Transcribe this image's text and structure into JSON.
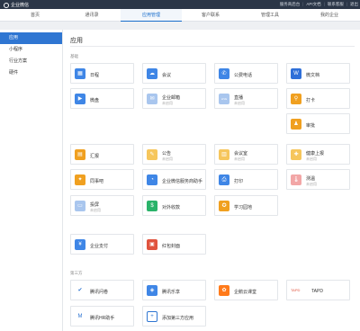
{
  "topbar": {
    "logo_text": "企业微信",
    "links": [
      "服务商后台",
      "API文档",
      "联系客服",
      "退出"
    ]
  },
  "nav": {
    "tabs": [
      "首页",
      "通讯录",
      "应用管理",
      "客户联系",
      "管理工具",
      "我的企业"
    ],
    "active": 2
  },
  "sidebar": {
    "items": [
      "应用",
      "小程序",
      "行业方案",
      "硬件"
    ],
    "active": 0
  },
  "main": {
    "title": "应用",
    "section_basic": "基础",
    "section_third": "第三方"
  },
  "cards": [
    {
      "name": "日程",
      "sub": "",
      "icon": "calendar-icon",
      "color": "#3f86e6",
      "glyph": "▦"
    },
    {
      "name": "会议",
      "sub": "",
      "icon": "meeting-icon",
      "color": "#3f86e6",
      "glyph": "☁"
    },
    {
      "name": "公费电话",
      "sub": "",
      "icon": "phone-icon",
      "color": "#3f86e6",
      "glyph": "✆"
    },
    {
      "name": "微文档",
      "sub": "",
      "icon": "document-icon",
      "color": "#2f6fd8",
      "glyph": "W"
    },
    {
      "name": "微盘",
      "sub": "",
      "icon": "drive-icon",
      "color": "#3f86e6",
      "glyph": "▶"
    },
    {
      "name": "企业邮箱",
      "sub": "未启用",
      "icon": "mail-icon",
      "color": "#a9c6ee",
      "glyph": "✉"
    },
    {
      "name": "直播",
      "sub": "未启用",
      "icon": "live-icon",
      "color": "#a9c6ee",
      "glyph": "LIVE"
    },
    {
      "name": "打卡",
      "sub": "",
      "icon": "checkin-icon",
      "color": "#f0a020",
      "glyph": "⚲"
    },
    {
      "name": "审批",
      "sub": "",
      "icon": "approval-icon",
      "color": "#f0a020",
      "glyph": "♟"
    },
    {
      "name": "汇报",
      "sub": "",
      "icon": "report-icon",
      "color": "#f0a020",
      "glyph": "▤"
    },
    {
      "name": "公告",
      "sub": "未启用",
      "icon": "announcement-icon",
      "color": "#f6c65c",
      "glyph": "✎"
    },
    {
      "name": "会议室",
      "sub": "未启用",
      "icon": "meeting-room-icon",
      "color": "#f6c65c",
      "glyph": "▥"
    },
    {
      "name": "健康上报",
      "sub": "未启用",
      "icon": "health-icon",
      "color": "#f6c65c",
      "glyph": "✚"
    },
    {
      "name": "同事吧",
      "sub": "",
      "icon": "colleague-icon",
      "color": "#f0a020",
      "glyph": "✦"
    },
    {
      "name": "企业微信服务商助手",
      "sub": "",
      "icon": "assistant-icon",
      "color": "#3f86e6",
      "glyph": "◔"
    },
    {
      "name": "打印",
      "sub": "",
      "icon": "print-icon",
      "color": "#3f86e6",
      "glyph": "⎙"
    },
    {
      "name": "测温",
      "sub": "未启用",
      "icon": "thermometer-icon",
      "color": "#f2a6a6",
      "glyph": "🌡"
    },
    {
      "name": "投屏",
      "sub": "未启用",
      "icon": "screen-icon",
      "color": "#a9c6ee",
      "glyph": "▭"
    },
    {
      "name": "对外收款",
      "sub": "",
      "icon": "payment-icon",
      "color": "#2ab36a",
      "glyph": "$"
    },
    {
      "name": "学习园地",
      "sub": "",
      "icon": "learning-icon",
      "color": "#f0a020",
      "glyph": "✪"
    },
    {
      "name": "企业支付",
      "sub": "",
      "icon": "enterprise-pay-icon",
      "color": "#3f86e6",
      "glyph": "¥"
    },
    {
      "name": "红包封面",
      "sub": "",
      "icon": "red-packet-icon",
      "color": "#e0533e",
      "glyph": "▣"
    },
    {
      "name": "腾讯问卷",
      "sub": "",
      "icon": "survey-icon",
      "color": "#ffffff",
      "glyph": "✔"
    },
    {
      "name": "腾讯乐享",
      "sub": "",
      "icon": "lexiang-icon",
      "color": "#3f86e6",
      "glyph": "◈"
    },
    {
      "name": "企鹅云课堂",
      "sub": "",
      "icon": "cloud-class-icon",
      "color": "#ff7a1a",
      "glyph": "✿"
    },
    {
      "name": "TAPD",
      "sub": "",
      "icon": "tapd-icon",
      "color": "#ffffff",
      "glyph": "TAPD"
    },
    {
      "name": "腾讯HR助手",
      "sub": "",
      "icon": "hr-assistant-icon",
      "color": "#ffffff",
      "glyph": "M"
    },
    {
      "name": "添加第三方应用",
      "sub": "",
      "icon": "add-icon",
      "color": "#ffffff",
      "glyph": "+"
    }
  ]
}
